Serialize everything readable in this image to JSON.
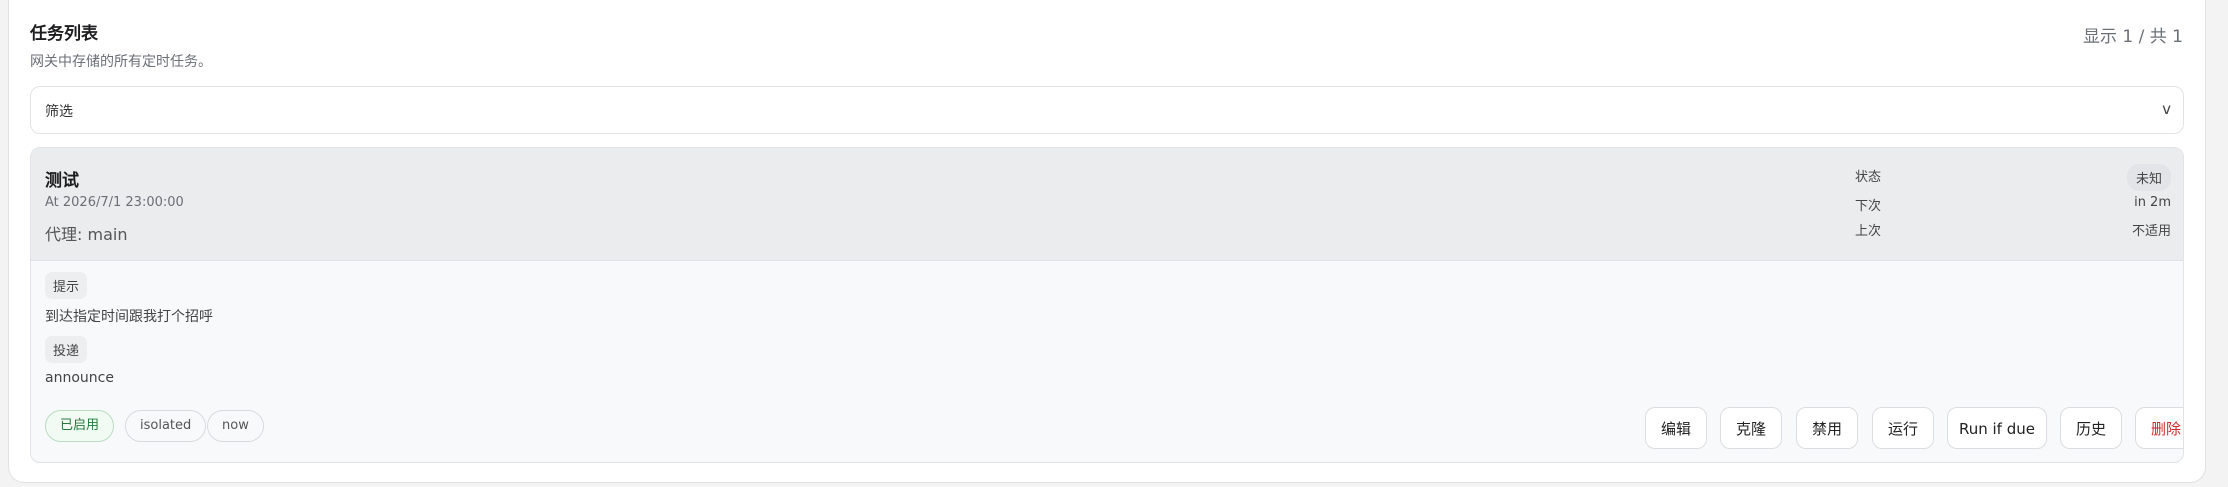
{
  "header": {
    "title": "任务列表",
    "subtitle": "网关中存储的所有定时任务。",
    "count": "显示 1 / 共 1"
  },
  "filter": {
    "label": "筛选",
    "chevron": "v"
  },
  "job": {
    "name": "测试",
    "schedule": "At 2026/7/1 23:00:00",
    "agent": "代理: main",
    "status_label": "状态",
    "status_value": "未知",
    "next_label": "下次",
    "next_value": "in 2m",
    "last_label": "上次",
    "last_value": "不适用",
    "prompt_label": "提示",
    "prompt_text": "到达指定时间跟我打个招呼",
    "delivery_label": "投递",
    "delivery_text": "announce",
    "pills": [
      "已启用",
      "isolated",
      "now"
    ],
    "actions": {
      "edit": "编辑",
      "clone": "克隆",
      "disable": "禁用",
      "run": "运行",
      "run_if_due": "Run if due",
      "history": "历史",
      "delete": "删除"
    }
  },
  "colors": {
    "enabled_green": "#237a3a",
    "delete_red": "#d12a2a",
    "card_header": "#ebecee"
  }
}
